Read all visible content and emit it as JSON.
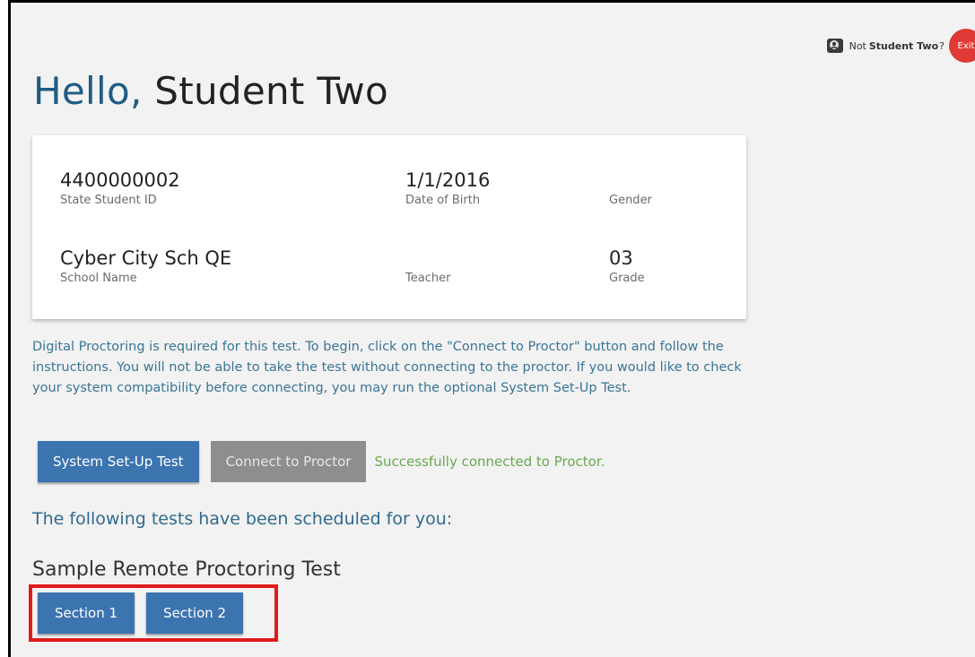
{
  "header": {
    "not_label": "Not",
    "student_name": "Student Two",
    "question_mark": "?",
    "exit_label": "Exit"
  },
  "greeting": {
    "hello": "Hello,",
    "name": "Student Two"
  },
  "student_info": {
    "state_student_id": {
      "value": "4400000002",
      "label": "State Student ID"
    },
    "date_of_birth": {
      "value": "1/1/2016",
      "label": "Date of Birth"
    },
    "gender": {
      "value": "",
      "label": "Gender"
    },
    "school_name": {
      "value": "Cyber City Sch QE",
      "label": "School Name"
    },
    "teacher": {
      "value": "",
      "label": "Teacher"
    },
    "grade": {
      "value": "03",
      "label": "Grade"
    }
  },
  "instructions": "Digital Proctoring is required for this test. To begin, click on the \"Connect to Proctor\" button and follow the instructions. You will not be able to take the test without connecting to the proctor. If you would like to check your system compatibility before connecting, you may run the optional System Set-Up Test.",
  "actions": {
    "system_setup_label": "System Set-Up Test",
    "connect_proctor_label": "Connect to Proctor",
    "status": "Successfully connected to Proctor."
  },
  "scheduled_heading": "The following tests have been scheduled for you:",
  "test": {
    "title": "Sample Remote Proctoring Test",
    "sections": [
      "Section 1",
      "Section 2"
    ]
  },
  "colors": {
    "primary_button": "#3c74b0",
    "disabled_button": "#8e8e8e",
    "success_text": "#6aa84f",
    "exit_button": "#e03a36",
    "highlight": "#e01b1b"
  },
  "icons": {
    "user_avatar": "user-avatar-icon"
  }
}
